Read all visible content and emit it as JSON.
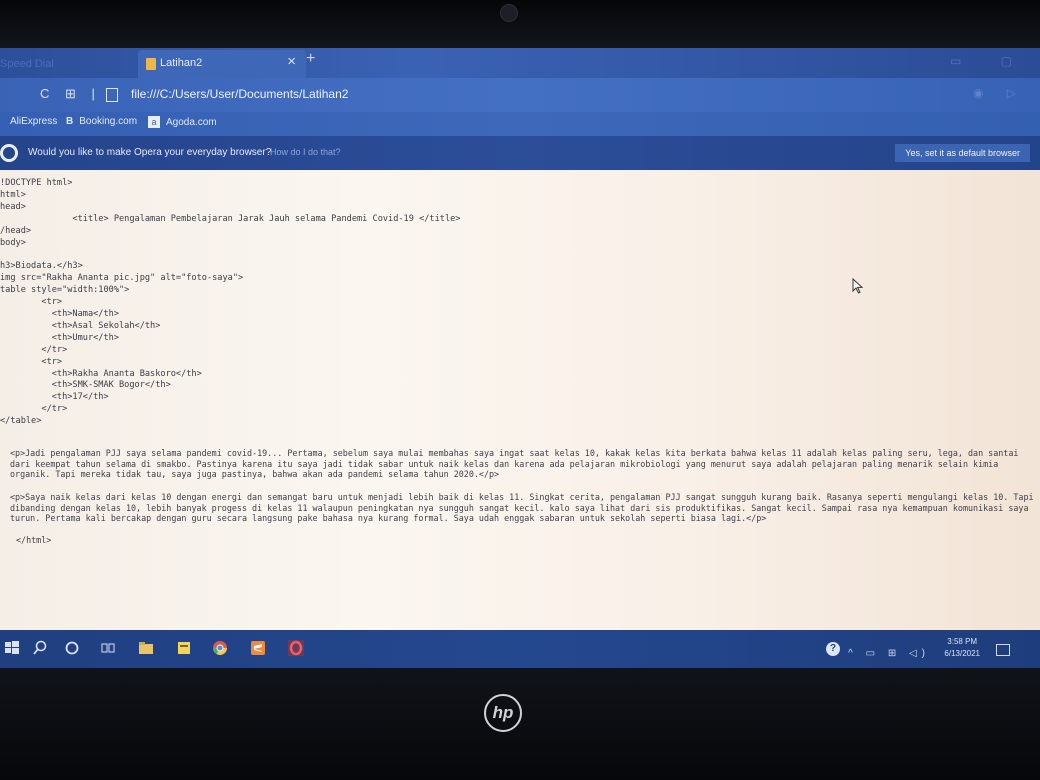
{
  "browser": {
    "prev_tab_label": "Speed Dial",
    "tab": {
      "title": "Latihan2",
      "close": "×",
      "new_tab": "+"
    },
    "nav_icons": "C ⊞ |",
    "url": "file:///C:/Users/User/Documents/Latihan2",
    "bookmarks": [
      {
        "label": "AliExpress"
      },
      {
        "icon": "B",
        "label": "Booking.com"
      },
      {
        "icon": "a",
        "label": "Agoda.com"
      }
    ],
    "notification": {
      "message": "Would you like to make Opera your everyday browser?",
      "help_link": "How do I do that?",
      "button": "Yes, set it as default browser"
    }
  },
  "source": {
    "code": "!DOCTYPE html>\nhtml>\nhead>\n              <title> Pengalaman Pembelajaran Jarak Jauh selama Pandemi Covid-19 </title>\n/head>\nbody>\n\nh3>Biodata.</h3>\nimg src=\"Rakha Ananta pic.jpg\" alt=\"foto-saya\">\ntable style=\"width:100%\">\n        <tr>\n          <th>Nama</th>\n          <th>Asal Sekolah</th>\n          <th>Umur</th>\n        </tr>\n        <tr>\n          <th>Rakha Ananta Baskoro</th>\n          <th>SMK-SMAK Bogor</th>\n          <th>17</th>\n        </tr>\n</table>",
    "paragraph1": "<p>Jadi pengalaman PJJ saya selama pandemi covid-19... Pertama, sebelum saya mulai membahas saya ingat saat kelas 10, kakak kelas kita berkata bahwa kelas 11 adalah kelas paling seru, lega, dan santai dari keempat tahun selama di smakbo. Pastinya karena itu saya jadi tidak sabar untuk naik kelas dan karena ada pelajaran mikrobiologi yang menurut saya adalah pelajaran paling menarik selain kimia organik. Tapi mereka tidak tau, saya juga pastinya, bahwa akan ada pandemi selama tahun 2020.</p>",
    "paragraph2": "<p>Saya naik kelas dari kelas 10 dengan energi dan semangat baru untuk menjadi lebih baik di kelas 11. Singkat cerita, pengalaman PJJ sangat sungguh kurang baik. Rasanya seperti mengulangi kelas 10. Tapi dibanding dengan kelas 10, lebih banyak progess di kelas 11 walaupun peningkatan nya sungguh sangat kecil. kalo saya lihat dari sis produktifikas. Sangat kecil. Sampai rasa nya kemampuan komunikasi saya turun. Pertama kali bercakap dengan guru secara langsung pake bahasa nya kurang formal. Saya udah enggak sabaran untuk sekolah seperti biasa lagi.</p>",
    "end_tag": "</html>"
  },
  "taskbar": {
    "time": "3:58 PM",
    "date": "6/13/2021",
    "help": "?",
    "tray": "^ ▭ ⊞ ◁)"
  },
  "laptop": {
    "brand": "hp"
  }
}
